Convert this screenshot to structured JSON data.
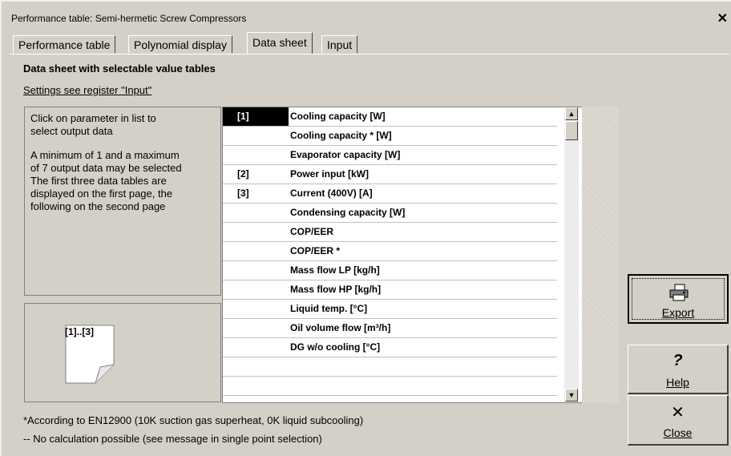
{
  "window": {
    "title": "Performance table: Semi-hermetic Screw Compressors",
    "close_glyph": "✕"
  },
  "tabs": [
    {
      "label": "Performance table",
      "active": false
    },
    {
      "label": "Polynomial display",
      "active": false
    },
    {
      "label": "Data sheet",
      "active": true
    },
    {
      "label": "Input",
      "active": false
    }
  ],
  "main": {
    "heading": "Data sheet with selectable value tables",
    "settings_link": "Settings see register \"Input\"",
    "info_lines": [
      "Click on parameter in list to",
      "select output data",
      "",
      "A minimum of 1 and a maximum",
      "of 7 output data may be selected",
      "The first three data tables are",
      "displayed on the first page, the",
      "following on the second page"
    ],
    "page_preview_label": "[1]..[3]",
    "parameters": [
      {
        "selection": "[1]",
        "label": "Cooling capacity [W]"
      },
      {
        "selection": "",
        "label": "Cooling capacity * [W]"
      },
      {
        "selection": "",
        "label": "Evaporator capacity [W]"
      },
      {
        "selection": "[2]",
        "label": "Power input [kW]"
      },
      {
        "selection": "[3]",
        "label": "Current (400V) [A]"
      },
      {
        "selection": "",
        "label": "Condensing capacity [W]"
      },
      {
        "selection": "",
        "label": "COP/EER"
      },
      {
        "selection": "",
        "label": "COP/EER *"
      },
      {
        "selection": "",
        "label": "Mass flow LP [kg/h]"
      },
      {
        "selection": "",
        "label": "Mass flow HP [kg/h]"
      },
      {
        "selection": "",
        "label": "Liquid temp. [°C]"
      },
      {
        "selection": "",
        "label": "Oil volume flow [m³/h]"
      },
      {
        "selection": "",
        "label": "DG w/o cooling [°C]"
      },
      {
        "selection": "",
        "label": ""
      },
      {
        "selection": "",
        "label": ""
      }
    ]
  },
  "buttons": {
    "export": {
      "label": "Export",
      "icon": "printer-icon"
    },
    "help": {
      "label": "Help",
      "glyph": "?"
    },
    "close": {
      "label": "Close",
      "glyph": "✕"
    }
  },
  "footnotes": {
    "line1": "*According to EN12900 (10K suction gas superheat, 0K liquid subcooling)",
    "line2": " -- No calculation possible (see message in single point selection)"
  },
  "colors": {
    "background": "#d4d0c8",
    "selection_highlight": "#000000"
  }
}
